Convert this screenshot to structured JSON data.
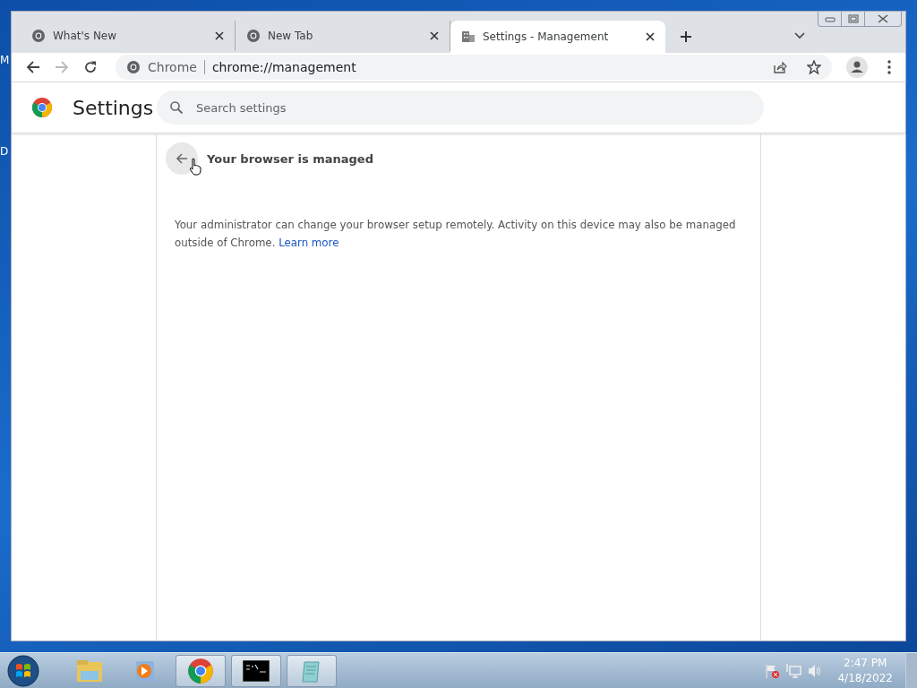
{
  "desktop": {
    "icon_labels": [
      "M",
      "D"
    ]
  },
  "tabs": [
    {
      "title": "What's New",
      "kind": "chrome",
      "selected": false
    },
    {
      "title": "New Tab",
      "kind": "chrome",
      "selected": false
    },
    {
      "title": "Settings - Management",
      "kind": "settings",
      "selected": true
    }
  ],
  "address_bar": {
    "origin": "Chrome",
    "url": "chrome://management"
  },
  "settings": {
    "title": "Settings",
    "search_placeholder": "Search settings"
  },
  "page": {
    "title": "Your browser is managed",
    "description": "Your administrator can change your browser setup remotely. Activity on this device may also be managed outside of Chrome.",
    "link": "Learn more"
  },
  "taskbar": {
    "apps": [
      {
        "kind": "explorer",
        "running": false
      },
      {
        "kind": "media",
        "running": false
      },
      {
        "kind": "chrome",
        "running": true
      },
      {
        "kind": "console",
        "running": true
      },
      {
        "kind": "notepad",
        "running": true
      }
    ],
    "time": "2:47 PM",
    "date": "4/18/2022"
  }
}
